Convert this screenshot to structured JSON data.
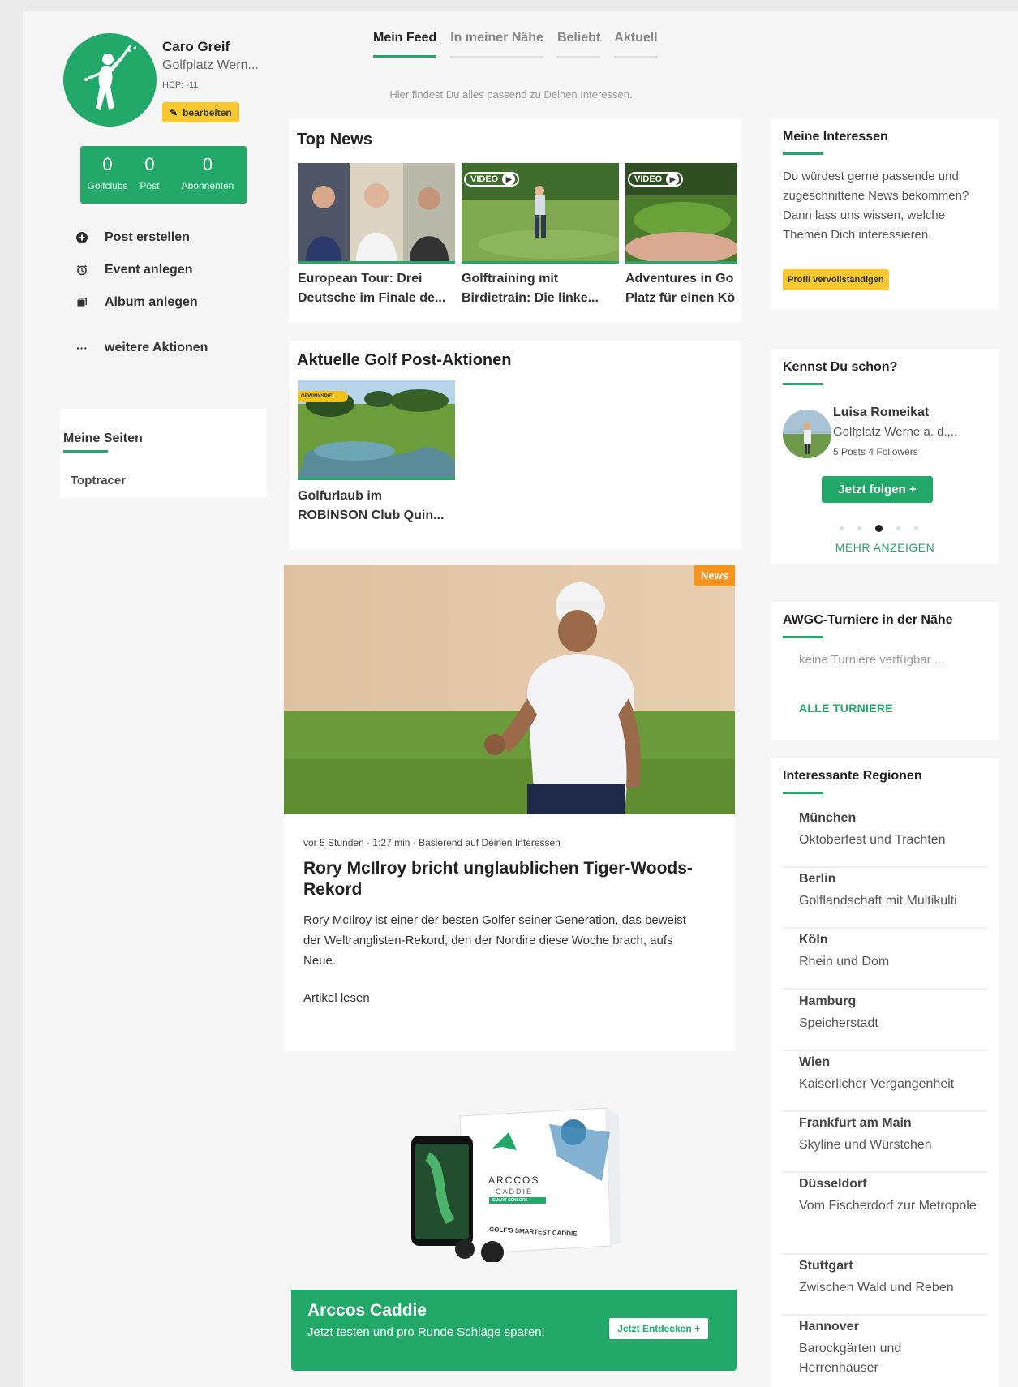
{
  "profile": {
    "name": "Caro Greif",
    "club": "Golfplatz Wern...",
    "hcp": "HCP: -11",
    "edit_label": "bearbeiten",
    "stats": [
      {
        "value": "0",
        "label": "Golfclubs"
      },
      {
        "value": "0",
        "label": "Post"
      },
      {
        "value": "0",
        "label": "Abonnenten"
      }
    ]
  },
  "actions": [
    {
      "icon": "plus-circle-icon",
      "label": "Post erstellen"
    },
    {
      "icon": "alarm-clock-icon",
      "label": "Event anlegen"
    },
    {
      "icon": "album-icon",
      "label": "Album anlegen"
    },
    {
      "icon": "more-dots-icon",
      "label": "weitere Aktionen"
    }
  ],
  "my_pages": {
    "title": "Meine Seiten",
    "items": [
      "Toptracer"
    ]
  },
  "tabs": [
    "Mein Feed",
    "In meiner Nähe",
    "Beliebt",
    "Aktuell"
  ],
  "feed_hint": "Hier findest Du alles passend zu Deinen Interessen.",
  "top_news": {
    "title": "Top News",
    "items": [
      {
        "line1": "European Tour: Drei",
        "line2": "Deutsche im Finale de...",
        "video": false
      },
      {
        "line1": "Golftraining mit",
        "line2": "Birdietrain: Die linke...",
        "video": true,
        "video_label": "VIDEO"
      },
      {
        "line1": "Adventures in Go",
        "line2": "Platz für einen Kö",
        "video": true,
        "video_label": "VIDEO"
      }
    ]
  },
  "post_actions": {
    "title": "Aktuelle Golf Post-Aktionen",
    "badge": "GEWINNSPIEL",
    "line1": "Golfurlaub im",
    "line2": "ROBINSON Club Quin..."
  },
  "article": {
    "badge": "News",
    "meta": "vor 5 Stunden · 1:27 min · Basierend auf Deinen Interessen",
    "title": "Rory McIlroy bricht unglaublichen Tiger-Woods-Rekord",
    "text": "Rory McIlroy ist einer der besten Golfer seiner Generation, das beweist der Weltranglisten-Rekord, den der Nordire diese Woche brach, aufs Neue.",
    "read_more": "Artikel lesen"
  },
  "ad": {
    "brand": "ARCCOS",
    "brand_sub": "CADDIE",
    "brand_tag": "SMART SENSORS",
    "box_text": "GOLF'S SMARTEST CADDIE",
    "title": "Arccos Caddie",
    "text": "Jetzt testen und pro Runde Schläge sparen!",
    "button": "Jetzt Entdecken +"
  },
  "interests": {
    "title": "Meine Interessen",
    "text": "Du würdest gerne passende und zugeschnittene News bekommen? Dann lass uns wissen, welche Themen Dich interessieren.",
    "button": "Profil vervollständigen"
  },
  "suggest": {
    "title": "Kennst Du schon?",
    "name": "Luisa Romeikat",
    "club": "Golfplatz Werne a. d.,..",
    "stats": "5 Posts  4 Followers",
    "follow": "Jetzt folgen  +",
    "more": "MEHR ANZEIGEN"
  },
  "tournaments": {
    "title": "AWGC-Turniere in der Nähe",
    "empty": "keine Turniere verfügbar ...",
    "link": "ALLE TURNIERE"
  },
  "regions": {
    "title": "Interessante Regionen",
    "items": [
      {
        "name": "München",
        "desc": "Oktoberfest und Trachten"
      },
      {
        "name": "Berlin",
        "desc": "Golflandschaft mit Multikulti"
      },
      {
        "name": "Köln",
        "desc": "Rhein und Dom"
      },
      {
        "name": "Hamburg",
        "desc": "Speicherstadt"
      },
      {
        "name": "Wien",
        "desc": "Kaiserlicher Vergangenheit"
      },
      {
        "name": "Frankfurt am Main",
        "desc": "Skyline und Würstchen"
      },
      {
        "name": "Düsseldorf",
        "desc": "Vom Fischerdorf zur Metropole"
      },
      {
        "name": "Stuttgart",
        "desc": "Zwischen Wald und Reben"
      },
      {
        "name": "Hannover",
        "desc": "Barockgärten und Herrenhäuser"
      }
    ]
  },
  "colors": {
    "accent": "#22a96a",
    "button_yellow": "#f7c830",
    "badge_orange": "#f5941e"
  }
}
